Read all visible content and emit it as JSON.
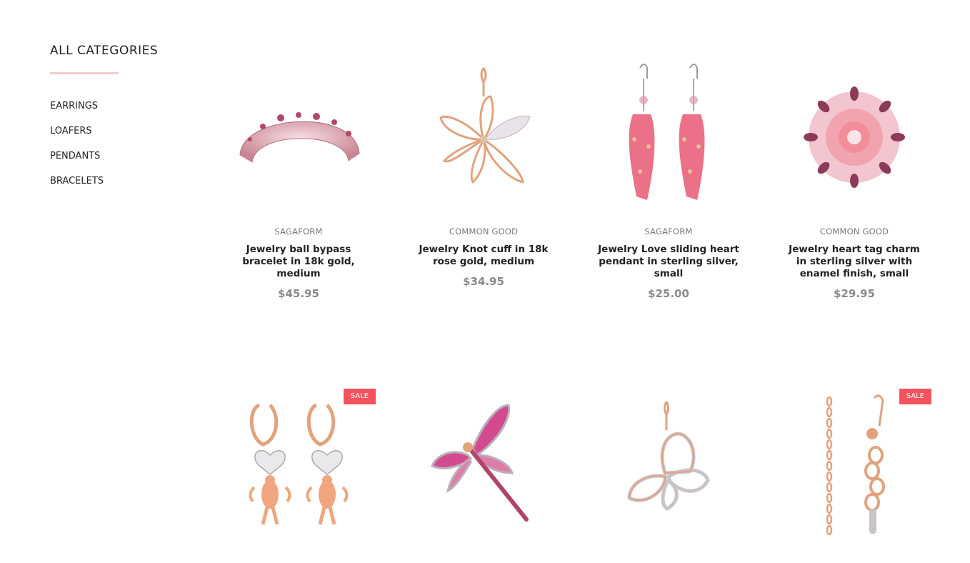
{
  "sidebar": {
    "title": "ALL CATEGORIES",
    "categories": [
      "EARRINGS",
      "LOAFERS",
      "PENDANTS",
      "BRACELETS"
    ]
  },
  "products": [
    {
      "brand": "SAGAFORM",
      "name": "Jewelry ball bypass bracelet in 18k gold, medium",
      "price": "$45.95",
      "image": "bracelet-cuff-icon"
    },
    {
      "brand": "COMMON GOOD",
      "name": "Jewelry Knot cuff in 18k rose gold, medium",
      "price": "$34.95",
      "image": "flower-pendant-icon"
    },
    {
      "brand": "SAGAFORM",
      "name": "Jewelry Love sliding heart pendant in sterling silver, small",
      "price": "$25.00",
      "image": "drop-earrings-icon"
    },
    {
      "brand": "COMMON GOOD",
      "name": "Jewelry heart tag charm in sterling silver with enamel finish, small",
      "price": "$29.95",
      "image": "brooch-icon"
    },
    {
      "badge": "SALE",
      "image": "cupid-earrings-icon"
    },
    {
      "image": "dragonfly-brooch-icon"
    },
    {
      "image": "butterfly-pendant-icon"
    },
    {
      "badge": "SALE",
      "image": "chain-bracelet-icon"
    }
  ],
  "colors": {
    "accent": "#f3c9cc",
    "sale": "#f4525f",
    "price": "#8a8a8a",
    "rose_gold": "#e2a27c",
    "pink": "#e8627a"
  }
}
